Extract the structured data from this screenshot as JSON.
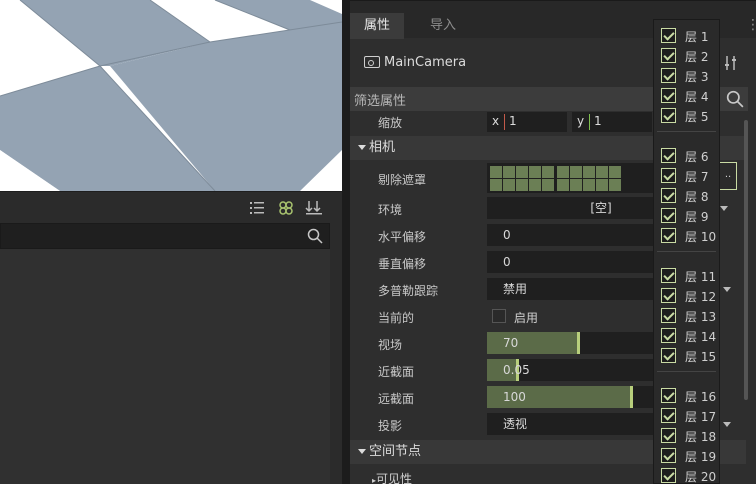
{
  "left_toolbar": {
    "icons": [
      "list-icon",
      "clover-icon",
      "download-sort-icon"
    ]
  },
  "inspector": {
    "tabs": [
      {
        "label": "属性"
      },
      {
        "label": "导入"
      }
    ],
    "node_name": "MainCamera",
    "filter_placeholder": "筛选属性",
    "scale": {
      "label": "缩放",
      "x_label": "x",
      "x_value": "1",
      "y_label": "y",
      "y_value": "1"
    },
    "camera_section": "相机",
    "cull_mask_label": "剔除遮罩",
    "cull_mask_button": "..",
    "environment": {
      "label": "环境",
      "value": "[空]"
    },
    "h_offset": {
      "label": "水平偏移",
      "value": "0"
    },
    "v_offset": {
      "label": "垂直偏移",
      "value": "0"
    },
    "doppler": {
      "label": "多普勒跟踪",
      "value": "禁用"
    },
    "current": {
      "label": "当前的",
      "value": "启用"
    },
    "fov": {
      "label": "视场",
      "value": "70",
      "fraction": 0.55
    },
    "near": {
      "label": "近截面",
      "value": "0.05",
      "fraction": 0.18
    },
    "far": {
      "label": "远截面",
      "value": "100",
      "fraction": 0.87
    },
    "projection": {
      "label": "投影",
      "value": "透视"
    },
    "spatial_section": "空间节点",
    "visibility_section": "可见性"
  },
  "layers": [
    {
      "label": "层 1",
      "checked": true
    },
    {
      "label": "层 2",
      "checked": true
    },
    {
      "label": "层 3",
      "checked": true
    },
    {
      "label": "层 4",
      "checked": true
    },
    {
      "label": "层 5",
      "checked": true
    },
    {
      "label": "层 6",
      "checked": true
    },
    {
      "label": "层 7",
      "checked": true
    },
    {
      "label": "层 8",
      "checked": true
    },
    {
      "label": "层 9",
      "checked": true
    },
    {
      "label": "层 10",
      "checked": true
    },
    {
      "label": "层 11",
      "checked": true
    },
    {
      "label": "层 12",
      "checked": true
    },
    {
      "label": "层 13",
      "checked": true
    },
    {
      "label": "层 14",
      "checked": true
    },
    {
      "label": "层 15",
      "checked": true
    },
    {
      "label": "层 16",
      "checked": true
    },
    {
      "label": "层 17",
      "checked": true
    },
    {
      "label": "层 18",
      "checked": true
    },
    {
      "label": "层 19",
      "checked": true
    },
    {
      "label": "层 20",
      "checked": true
    }
  ],
  "colors": {
    "accent": "#c9dba4",
    "slider_fill": "#5b6b48",
    "panel_bg": "#2e2e2e",
    "viewport_tile": "#94a3b3"
  }
}
